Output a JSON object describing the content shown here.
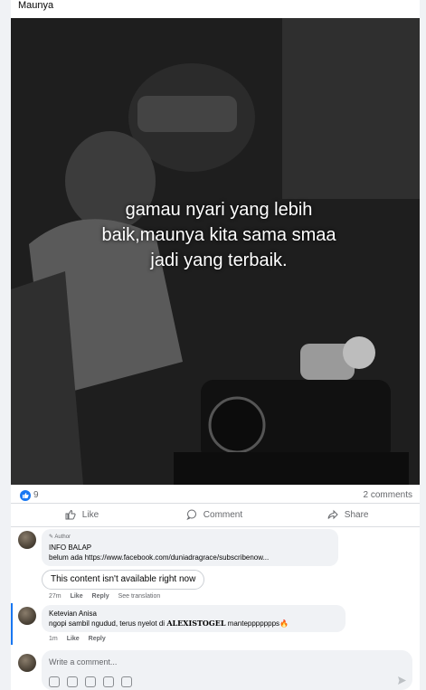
{
  "post": {
    "caption": "Maunya",
    "overlay_lines": [
      "gamau nyari yang lebih",
      "baik,maunya kita sama smaa",
      "jadi yang terbaik."
    ],
    "reaction_count": "9",
    "comment_count": "2 comments"
  },
  "actions": {
    "like": "Like",
    "comment": "Comment",
    "share": "Share"
  },
  "comments": [
    {
      "author_tag": "Author",
      "name": "INFO BALAP",
      "text": "belum ada https://www.facebook.com/duniadragrace/subscribenow...",
      "unavailable": "This content isn't available right now",
      "time": "27m",
      "like": "Like",
      "reply": "Reply",
      "translation": "See translation"
    },
    {
      "name": "Ketevian Anisa",
      "text_before": "ngopi sambil ngudud, terus nyelot di ",
      "text_bold": "ALEXISTOGEL",
      "text_after": " manteppppppps🔥",
      "time": "1m",
      "like": "Like",
      "reply": "Reply"
    }
  ],
  "write": {
    "placeholder": "Write a comment..."
  },
  "colors": {
    "accent": "#1877f2",
    "muted": "#65676b"
  }
}
